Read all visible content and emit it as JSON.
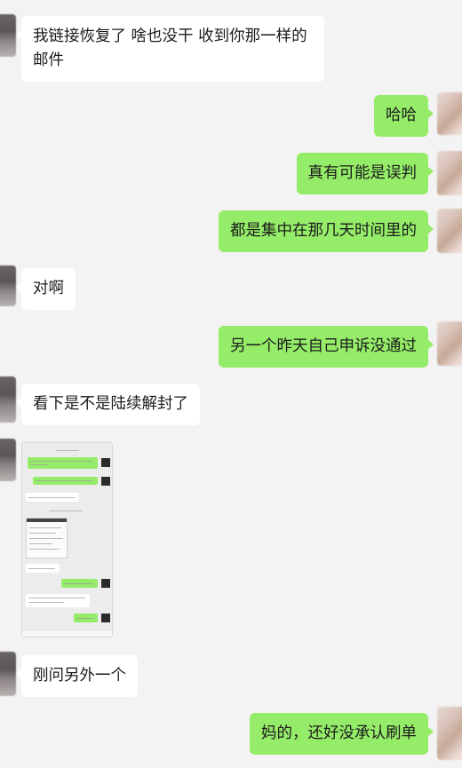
{
  "messages": [
    {
      "text": "我链接恢复了 啥也没干 收到你那一样的邮件"
    },
    {
      "text": "哈哈"
    },
    {
      "text": "真有可能是误判"
    },
    {
      "text": "都是集中在那几天时间里的"
    },
    {
      "text": "对啊"
    },
    {
      "text": "另一个昨天自己申诉没通过"
    },
    {
      "text": "看下是不是陆续解封了"
    },
    {
      "text": "刚问另外一个"
    },
    {
      "text": "妈的，还好没承认刷单"
    }
  ],
  "colors": {
    "background": "#f3f3f3",
    "outgoing_bubble": "#95ec69",
    "incoming_bubble": "#ffffff",
    "text": "#1b1b1b"
  }
}
